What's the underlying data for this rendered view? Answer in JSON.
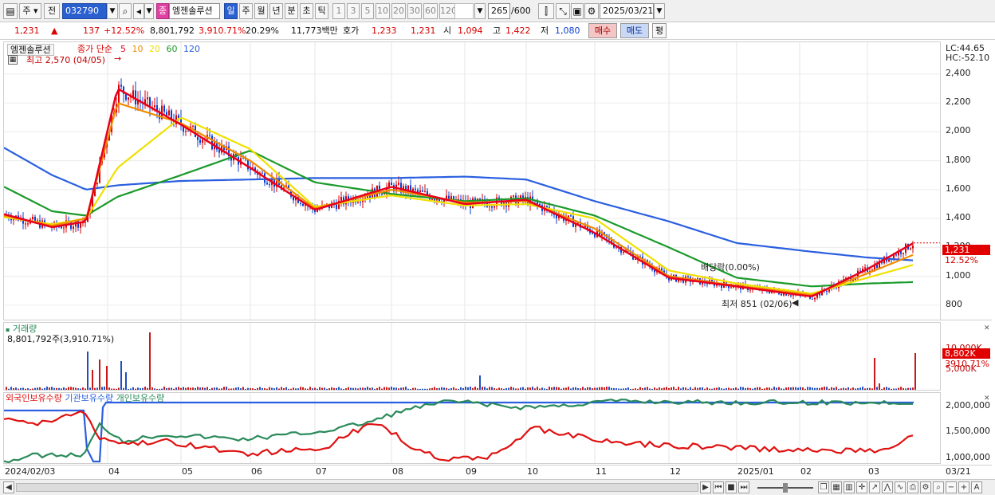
{
  "toolbar": {
    "market_label": "주",
    "prev_label": "전",
    "stock_code": "032790",
    "stock_type_badge": "종",
    "stock_name": "엠젠솔루션",
    "periods": [
      "일",
      "주",
      "월",
      "년",
      "분",
      "초",
      "틱"
    ],
    "selected_period": "일",
    "intervals": [
      "1",
      "3",
      "5",
      "10",
      "20",
      "30",
      "60",
      "120"
    ],
    "count_value": "265",
    "count_total": "/600",
    "date_value": "2025/03/21"
  },
  "quote": {
    "price": "1,231",
    "change": "137",
    "change_rate": "+12.52%",
    "volume": "8,801,792",
    "volume_rate": "3,910.71%",
    "turnover": "20.29%",
    "amount": "11,773백만",
    "bid_label": "호가",
    "bid": "1,233",
    "ask": "1,231",
    "open_label": "시",
    "open": "1,094",
    "high_label": "고",
    "high": "1,422",
    "low_label": "저",
    "low": "1,080",
    "buy_label": "매수",
    "sell_label": "매도",
    "eval_label": "평"
  },
  "price_panel": {
    "stock_tag": "엠젠솔루션",
    "ma_label": "종가 단순",
    "ma_periods": [
      "5",
      "10",
      "20",
      "60",
      "120"
    ],
    "ma_colors": [
      "#e8001c",
      "#f08c00",
      "#f0e000",
      "#1a9a2a",
      "#2a5fe0"
    ],
    "high_note": "최고 2,570 (04/05)",
    "low_note": "최저 851 (02/06)",
    "dividend_note": "배당락(0.00%)",
    "lc": "LC:44.65",
    "hc": "HC:-52.10",
    "price_tag": "1,231",
    "rate_tag": "12.52%",
    "y_labels": [
      "2,400",
      "2,200",
      "2,000",
      "1,800",
      "1,600",
      "1,400",
      "1,200",
      "1,000",
      "800"
    ]
  },
  "volume_panel": {
    "title": "거래량",
    "value_note": "8,801,792주(3,910.71%)",
    "y_labels": [
      "10,000K",
      "5,000K"
    ],
    "vol_tag": "8,802K",
    "rate_tag": "3910.71%"
  },
  "holdings_panel": {
    "foreign_label": "외국인보유수량",
    "inst_label": "기관보유수량",
    "indiv_label": "개인보유수량",
    "y_labels": [
      "2,000,000",
      "1,500,000",
      "1,000,000"
    ]
  },
  "x_axis": {
    "labels": [
      "2024/02/03",
      "04",
      "05",
      "06",
      "07",
      "08",
      "09",
      "10",
      "11",
      "12",
      "2025/01",
      "02",
      "03"
    ],
    "right_label": "03/21"
  },
  "colors": {
    "up": "#d90000",
    "down": "#0a3fd0",
    "foreign_line": "#e01010",
    "inst_line": "#2a5fe0",
    "indiv_line": "#2a8a5a",
    "volume_up": "#c81818",
    "volume_down": "#1f4fbf"
  },
  "chart_data": {
    "type": "line",
    "title": "",
    "xlabel": "",
    "ylabel": "",
    "ylim": [
      800,
      2570
    ],
    "x": [
      "2024-02-03",
      "2024-03-01",
      "2024-03-20",
      "2024-04-05",
      "2024-05-01",
      "2024-06-01",
      "2024-07-01",
      "2024-08-01",
      "2024-09-01",
      "2024-10-01",
      "2024-11-01",
      "2024-12-01",
      "2025-01-01",
      "2025-02-06",
      "2025-03-01",
      "2025-03-21"
    ],
    "series": [
      {
        "name": "5",
        "values": [
          1430,
          1340,
          1380,
          2300,
          2050,
          1750,
          1460,
          1620,
          1500,
          1530,
          1300,
          990,
          930,
          860,
          1050,
          1231
        ]
      },
      {
        "name": "10",
        "values": [
          1420,
          1350,
          1400,
          2200,
          2060,
          1800,
          1470,
          1600,
          1510,
          1520,
          1330,
          1000,
          935,
          870,
          1020,
          1150
        ]
      },
      {
        "name": "20",
        "values": [
          1410,
          1360,
          1400,
          1750,
          2100,
          1880,
          1480,
          1560,
          1490,
          1500,
          1400,
          1040,
          950,
          880,
          990,
          1080
        ]
      },
      {
        "name": "60",
        "values": [
          1620,
          1450,
          1420,
          1550,
          1700,
          1870,
          1650,
          1570,
          1520,
          1540,
          1420,
          1200,
          990,
          930,
          950,
          960
        ]
      },
      {
        "name": "120",
        "values": [
          1890,
          1700,
          1600,
          1630,
          1660,
          1670,
          1680,
          1680,
          1690,
          1670,
          1520,
          1380,
          1230,
          1170,
          1130,
          1110
        ]
      }
    ]
  }
}
